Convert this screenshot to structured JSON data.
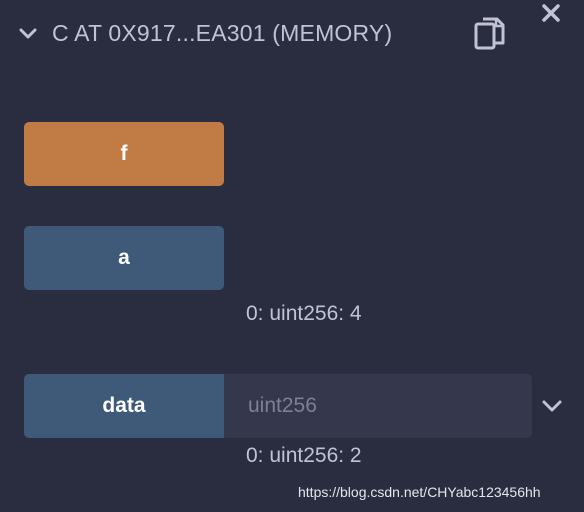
{
  "header": {
    "title": "C AT 0X917...EA301 (MEMORY)",
    "icons": {
      "collapse": "chevron-down-icon",
      "copy": "copy-icon",
      "close": "close-icon"
    }
  },
  "functions": [
    {
      "label": "f",
      "color": "#c17c45"
    },
    {
      "label": "a",
      "color": "#3e5a78",
      "result": "0: uint256: 4"
    },
    {
      "label": "data",
      "color": "#3e5a78",
      "input_placeholder": "uint256",
      "input_value": "",
      "result": "0: uint256: 2"
    }
  ],
  "watermark": "https://blog.csdn.net/CHYabc123456hh"
}
